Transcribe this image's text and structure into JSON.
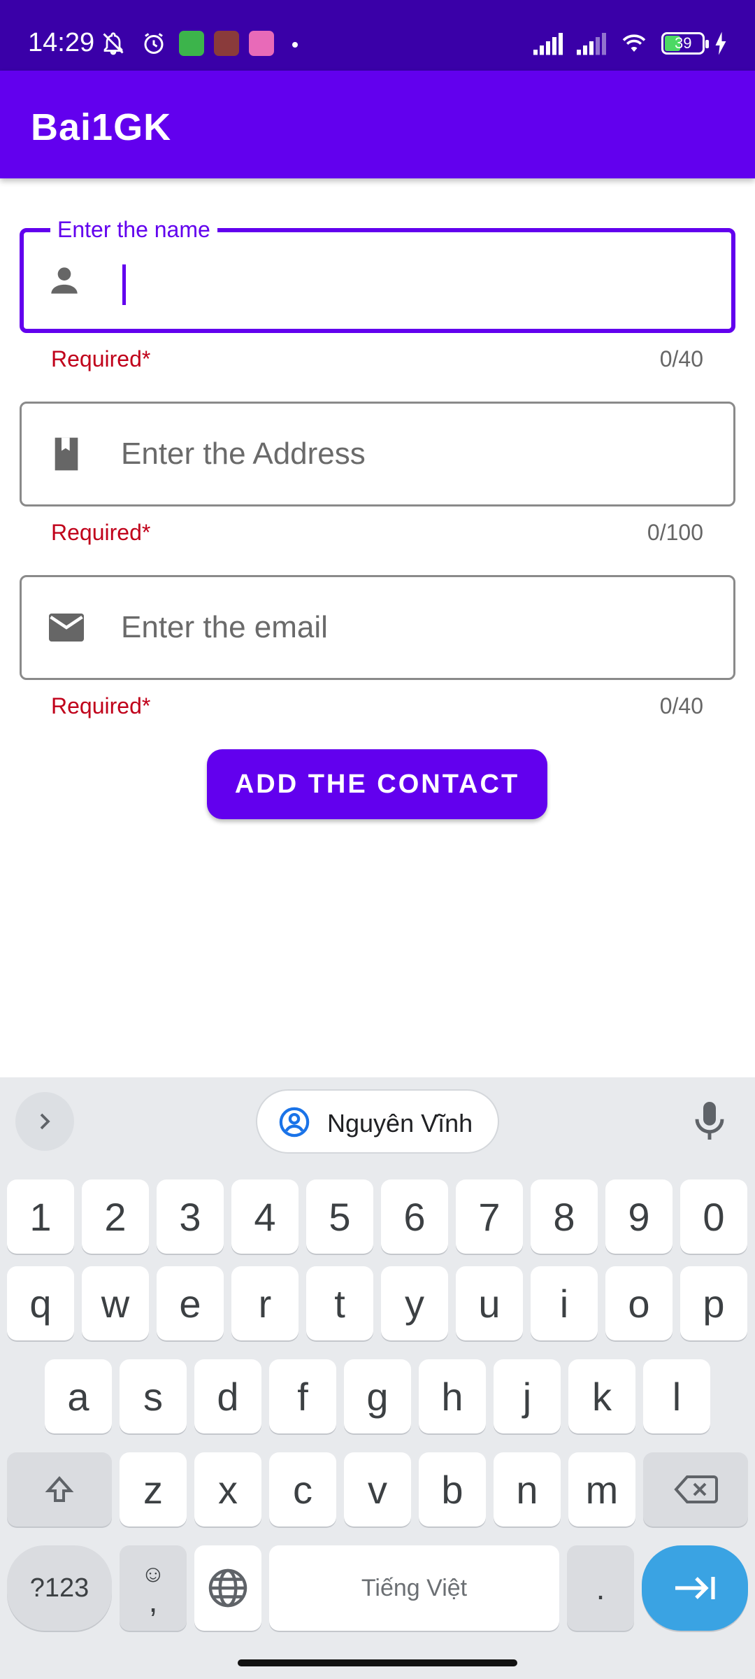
{
  "status_bar": {
    "time": "14:29",
    "battery_level": "39",
    "icons": [
      "mute-notifications-icon",
      "alarm-icon",
      "app-notification-icon",
      "signal-strength-icon",
      "wifi-icon",
      "battery-icon",
      "charging-icon"
    ]
  },
  "app_bar": {
    "title": "Bai1GK"
  },
  "form": {
    "name": {
      "label": "Enter the name",
      "value": "",
      "helper": "Required*",
      "counter": "0/40",
      "icon": "person-icon"
    },
    "address": {
      "placeholder": "Enter the Address",
      "value": "",
      "helper": "Required*",
      "counter": "0/100",
      "icon": "book-icon"
    },
    "email": {
      "placeholder": "Enter the email",
      "value": "",
      "helper": "Required*",
      "counter": "0/40",
      "icon": "mail-icon"
    },
    "submit_label": "ADD THE CONTACT"
  },
  "keyboard": {
    "suggestion": "Nguyên Vĩnh",
    "number_row": [
      "1",
      "2",
      "3",
      "4",
      "5",
      "6",
      "7",
      "8",
      "9",
      "0"
    ],
    "row1": [
      "q",
      "w",
      "e",
      "r",
      "t",
      "y",
      "u",
      "i",
      "o",
      "p"
    ],
    "row2": [
      "a",
      "s",
      "d",
      "f",
      "g",
      "h",
      "j",
      "k",
      "l"
    ],
    "row3": [
      "z",
      "x",
      "c",
      "v",
      "b",
      "n",
      "m"
    ],
    "symbols_label": "?123",
    "emoji_glyph": "☺",
    "comma": ",",
    "space_label": "Tiếng Việt",
    "period": "."
  },
  "colors": {
    "status_bar": "#3a00a8",
    "primary": "#6200ee",
    "error": "#c0001a",
    "enter_key": "#3aa3e3"
  }
}
